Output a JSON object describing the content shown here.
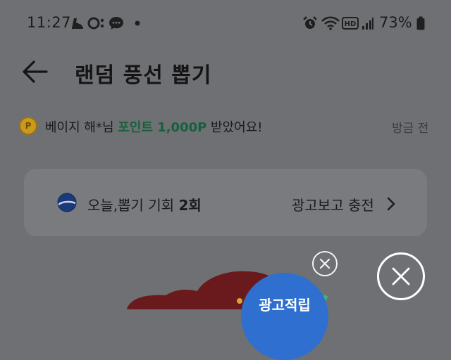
{
  "status_bar": {
    "time": "11:27",
    "battery_percent": "73%",
    "icons": [
      "notification-shoe-icon",
      "notification-o-icon",
      "chat-bubble-icon",
      "dot-icon",
      "alarm-icon",
      "wifi-icon",
      "hd-icon",
      "signal-icon",
      "battery-icon"
    ]
  },
  "header": {
    "title": "랜덤 풍선 뽑기",
    "back_icon": "arrow-left-icon"
  },
  "notice": {
    "coin_letter": "P",
    "prefix": "베이지 해*님 ",
    "highlight": "포인트 1,000P",
    "suffix": " 받았어요!",
    "time": "방금 전"
  },
  "chance_card": {
    "label": "오늘,뽑기 기회 ",
    "count": "2회",
    "ad_link": "광고보고 충전"
  },
  "bottom": {
    "ad_badge_label": "광고적립"
  },
  "colors": {
    "overlay": "#6f7073",
    "highlight_green": "#17603f",
    "balloon_red": "#6a1a1c",
    "badge_blue": "#2e6fcf"
  }
}
